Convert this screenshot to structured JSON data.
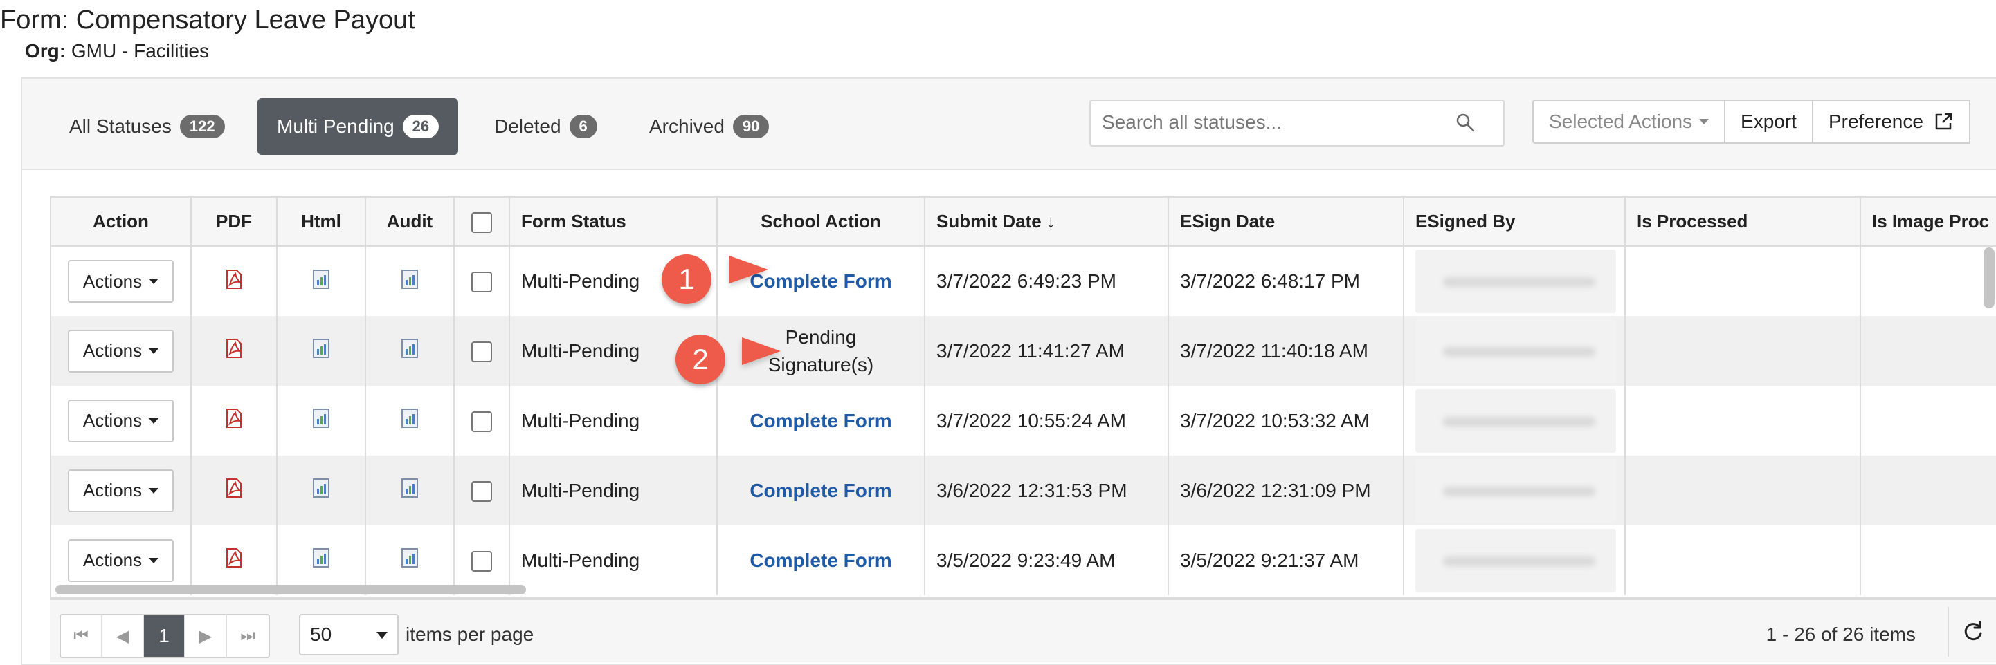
{
  "header": {
    "form_label": "Form:",
    "form_name": "Compensatory Leave Payout",
    "org_label": "Org:",
    "org_name": "GMU - Facilities"
  },
  "tabs": [
    {
      "label": "All Statuses",
      "count": "122",
      "active": false
    },
    {
      "label": "Multi Pending",
      "count": "26",
      "active": true
    },
    {
      "label": "Deleted",
      "count": "6",
      "active": false
    },
    {
      "label": "Archived",
      "count": "90",
      "active": false
    }
  ],
  "search": {
    "placeholder": "Search all statuses...",
    "value": ""
  },
  "toolbar": {
    "selected_actions": "Selected Actions",
    "export": "Export",
    "preference": "Preference"
  },
  "columns": [
    "Action",
    "PDF",
    "Html",
    "Audit",
    "",
    "Form Status",
    "School Action",
    "Submit Date ↓",
    "ESign Date",
    "ESigned By",
    "Is Processed",
    "Is Image Proc"
  ],
  "rows": [
    {
      "action": "Actions",
      "form_status": "Multi-Pending",
      "school_action": "Complete Form",
      "school_action_is_link": true,
      "submit_date": "3/7/2022 6:49:23 PM",
      "esign_date": "3/7/2022 6:48:17 PM"
    },
    {
      "action": "Actions",
      "form_status": "Multi-Pending",
      "school_action": "Pending Signature(s)",
      "school_action_is_link": false,
      "submit_date": "3/7/2022 11:41:27 AM",
      "esign_date": "3/7/2022 11:40:18 AM"
    },
    {
      "action": "Actions",
      "form_status": "Multi-Pending",
      "school_action": "Complete Form",
      "school_action_is_link": true,
      "submit_date": "3/7/2022 10:55:24 AM",
      "esign_date": "3/7/2022 10:53:32 AM"
    },
    {
      "action": "Actions",
      "form_status": "Multi-Pending",
      "school_action": "Complete Form",
      "school_action_is_link": true,
      "submit_date": "3/6/2022 12:31:53 PM",
      "esign_date": "3/6/2022 12:31:09 PM"
    },
    {
      "action": "Actions",
      "form_status": "Multi-Pending",
      "school_action": "Complete Form",
      "school_action_is_link": true,
      "submit_date": "3/5/2022 9:23:49 AM",
      "esign_date": "3/5/2022 9:21:37 AM"
    }
  ],
  "callouts": [
    "1",
    "2"
  ],
  "pager": {
    "current_page": "1",
    "per_page": "50",
    "per_page_label": "items per page",
    "range": "1 - 26 of 26 items"
  },
  "colors": {
    "accent": "#555b61",
    "link": "#1f5aa6",
    "callout": "#ef5b4a",
    "pdf_icon": "#c8302c"
  }
}
